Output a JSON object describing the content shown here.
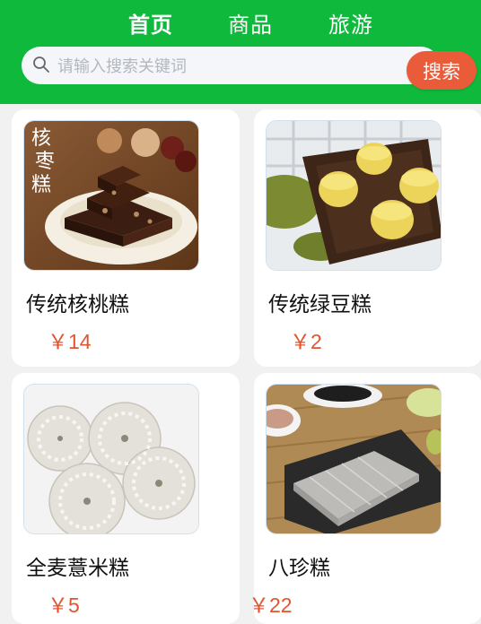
{
  "nav": {
    "tabs": [
      {
        "label": "首页",
        "active": true
      },
      {
        "label": "商品",
        "active": false
      },
      {
        "label": "旅游",
        "active": false
      }
    ]
  },
  "search": {
    "placeholder": "请输入搜索关键词",
    "value": "",
    "button_label": "搜索"
  },
  "products": [
    {
      "name": "传统核桃糕",
      "price": "￥14",
      "image_text": "核枣糕"
    },
    {
      "name": "传统绿豆糕",
      "price": "￥2"
    },
    {
      "name": "全麦薏米糕",
      "price": "￥5"
    },
    {
      "name": "八珍糕",
      "price": "￥22"
    }
  ],
  "colors": {
    "header_bg": "#0eb93c",
    "accent": "#ea5b3a",
    "price": "#e2542f",
    "page_bg": "#f1f1f1"
  }
}
